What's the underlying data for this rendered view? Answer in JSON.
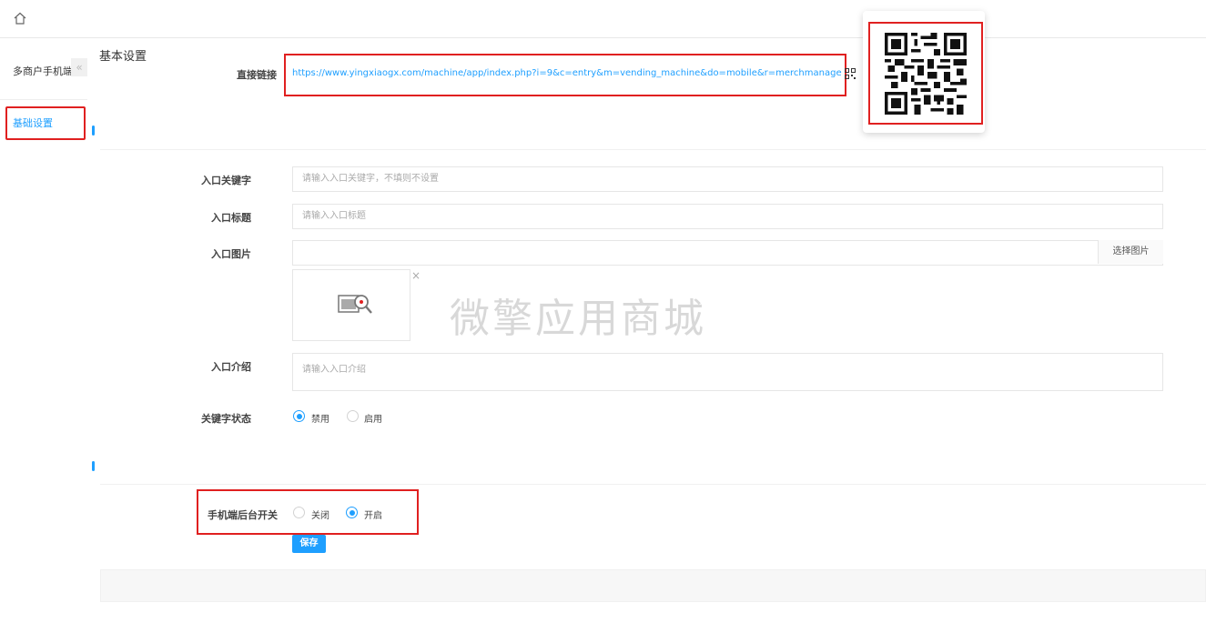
{
  "topbar": {
    "home_icon": "home-icon"
  },
  "sidebar": {
    "title": "多商户手机端",
    "collapse_icon": "«",
    "items": [
      {
        "label": "基础设置",
        "active": true
      }
    ]
  },
  "main": {
    "section_title": "基本设置",
    "direct_link": {
      "label": "直接链接",
      "url": "https://www.yingxiaogx.com/machine/app/index.php?i=9&c=entry&m=vending_machine&do=mobile&r=merchmanage",
      "qr_icon": "qr-icon"
    },
    "keyword": {
      "label": "入口关键字",
      "placeholder": "请输入入口关键字，不填则不设置"
    },
    "title_field": {
      "label": "入口标题",
      "placeholder": "请输入入口标题"
    },
    "image": {
      "label": "入口图片",
      "button": "选择图片",
      "close": "×",
      "watermark": "微擎应用商城"
    },
    "intro": {
      "label": "入口介绍",
      "placeholder": "请输入入口介绍"
    },
    "keyword_status": {
      "label": "关键字状态",
      "options": [
        {
          "label": "禁用",
          "checked": true
        },
        {
          "label": "启用",
          "checked": false
        }
      ]
    },
    "mobile_switch": {
      "label": "手机端后台开关",
      "options": [
        {
          "label": "关闭",
          "checked": false
        },
        {
          "label": "开启",
          "checked": true
        }
      ]
    },
    "save_label": "保存"
  },
  "colors": {
    "accent": "#1e9fff",
    "highlight": "#e02020"
  }
}
